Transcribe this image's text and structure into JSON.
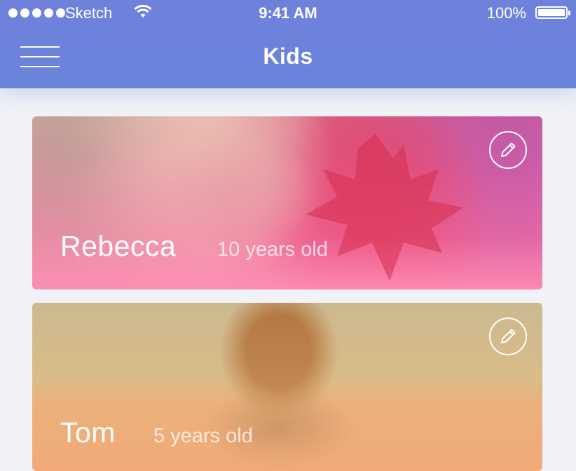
{
  "status_bar": {
    "carrier": "Sketch",
    "time": "9:41 AM",
    "battery": "100%"
  },
  "header": {
    "title": "Kids"
  },
  "kids": [
    {
      "name": "Rebecca",
      "age": "10 years old"
    },
    {
      "name": "Tom",
      "age": "5 years old"
    }
  ],
  "colors": {
    "header": "#6e82dc",
    "background": "#f0f2f7"
  },
  "icons": {
    "menu": "hamburger-menu-icon",
    "edit": "pencil-icon"
  }
}
